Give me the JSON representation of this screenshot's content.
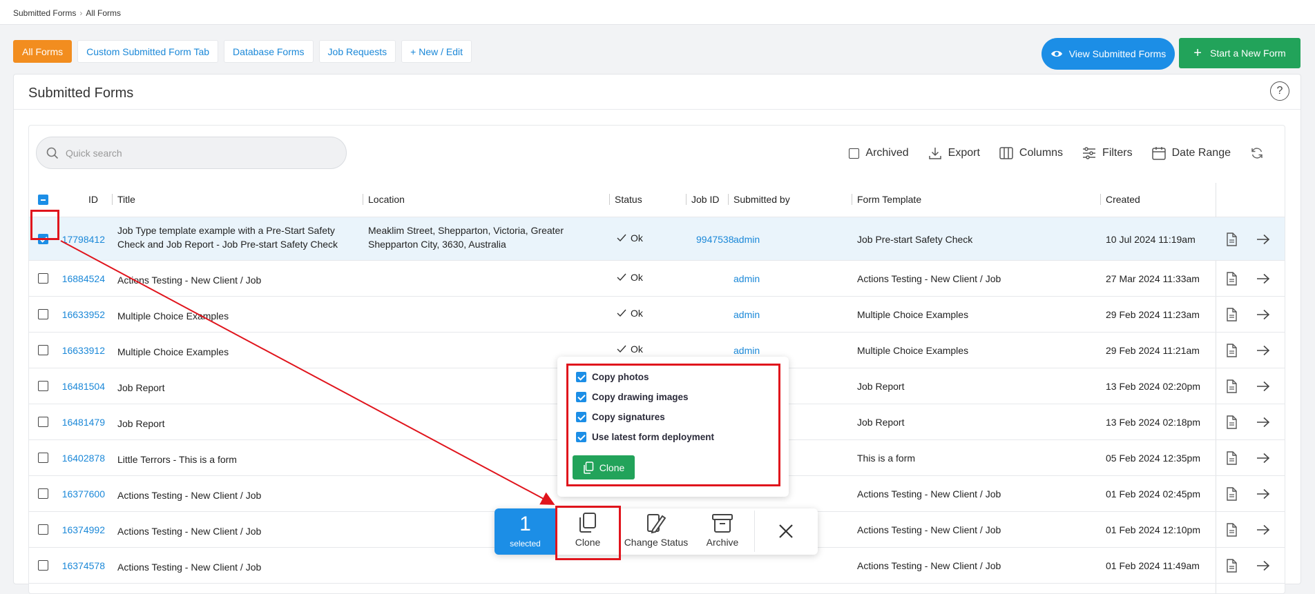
{
  "breadcrumb": [
    "Submitted Forms",
    "All Forms"
  ],
  "tabs": [
    "All Forms",
    "Custom Submitted Form Tab",
    "Database Forms",
    "Job Requests",
    "+ New / Edit"
  ],
  "buttons": {
    "view": "View Submitted Forms",
    "start": "Start a New Form"
  },
  "card_title": "Submitted Forms",
  "help": "?",
  "search_placeholder": "Quick search",
  "toolbar": {
    "archived": "Archived",
    "export": "Export",
    "columns": "Columns",
    "filters": "Filters",
    "date_range": "Date Range"
  },
  "columns": {
    "id": "ID",
    "title": "Title",
    "location": "Location",
    "status": "Status",
    "job_id": "Job ID",
    "submitted_by": "Submitted by",
    "form_template": "Form Template",
    "created": "Created"
  },
  "rows": [
    {
      "id": "17798412",
      "title": [
        "Job Type template example with a Pre-Start Safety",
        "Check and Job Report - Job Pre-start Safety Check"
      ],
      "location": [
        "Meaklim Street, Shepparton, Victoria, Greater",
        "Shepparton City, 3630, Australia"
      ],
      "status": "Ok",
      "job_id": "9947538",
      "submitted_by": "admin",
      "template": "Job Pre-start Safety Check",
      "created": "10 Jul 2024 11:19am",
      "selected": true
    },
    {
      "id": "16884524",
      "title": [
        "Actions Testing - New Client / Job"
      ],
      "location": [],
      "status": "Ok",
      "job_id": "",
      "submitted_by": "admin",
      "template": "Actions Testing - New Client / Job",
      "created": "27 Mar 2024 11:33am"
    },
    {
      "id": "16633952",
      "title": [
        "Multiple Choice Examples"
      ],
      "location": [],
      "status": "Ok",
      "job_id": "",
      "submitted_by": "admin",
      "template": "Multiple Choice Examples",
      "created": "29 Feb 2024 11:23am"
    },
    {
      "id": "16633912",
      "title": [
        "Multiple Choice Examples"
      ],
      "location": [],
      "status": "Ok",
      "job_id": "",
      "submitted_by": "admin",
      "template": "Multiple Choice Examples",
      "created": "29 Feb 2024 11:21am"
    },
    {
      "id": "16481504",
      "title": [
        "Job Report"
      ],
      "location": [],
      "status": "",
      "job_id": "",
      "submitted_by": "",
      "template": "Job Report",
      "created": "13 Feb 2024 02:20pm"
    },
    {
      "id": "16481479",
      "title": [
        "Job Report"
      ],
      "location": [],
      "status": "",
      "job_id": "",
      "submitted_by": "",
      "template": "Job Report",
      "created": "13 Feb 2024 02:18pm"
    },
    {
      "id": "16402878",
      "title": [
        "Little Terrors - This is a form"
      ],
      "location": [],
      "status": "",
      "job_id": "",
      "submitted_by": "",
      "template": "This is a form",
      "created": "05 Feb 2024 12:35pm"
    },
    {
      "id": "16377600",
      "title": [
        "Actions Testing - New Client / Job"
      ],
      "location": [],
      "status": "",
      "job_id": "",
      "submitted_by": "",
      "template": "Actions Testing - New Client / Job",
      "created": "01 Feb 2024 02:45pm"
    },
    {
      "id": "16374992",
      "title": [
        "Actions Testing - New Client / Job"
      ],
      "location": [],
      "status": "",
      "job_id": "",
      "submitted_by": "",
      "template": "Actions Testing - New Client / Job",
      "created": "01 Feb 2024 12:10pm"
    },
    {
      "id": "16374578",
      "title": [
        "Actions Testing - New Client / Job"
      ],
      "location": [],
      "status": "",
      "job_id": "",
      "submitted_by": "",
      "template": "Actions Testing - New Client / Job",
      "created": "01 Feb 2024 11:49am"
    }
  ],
  "clone_popup": {
    "options": [
      {
        "label": "Copy photos",
        "checked": true
      },
      {
        "label": "Copy drawing images",
        "checked": true
      },
      {
        "label": "Copy signatures",
        "checked": true
      },
      {
        "label": "Use latest form deployment",
        "checked": true
      }
    ],
    "button": "Clone"
  },
  "action_bar": {
    "count": "1",
    "count_label": "selected",
    "clone": "Clone",
    "change_status": "Change Status",
    "archive": "Archive"
  },
  "colors": {
    "accent_orange": "#f28d1f",
    "primary_blue": "#1c8ee6",
    "success_green": "#22a35a",
    "highlight_red": "#e0141c"
  }
}
